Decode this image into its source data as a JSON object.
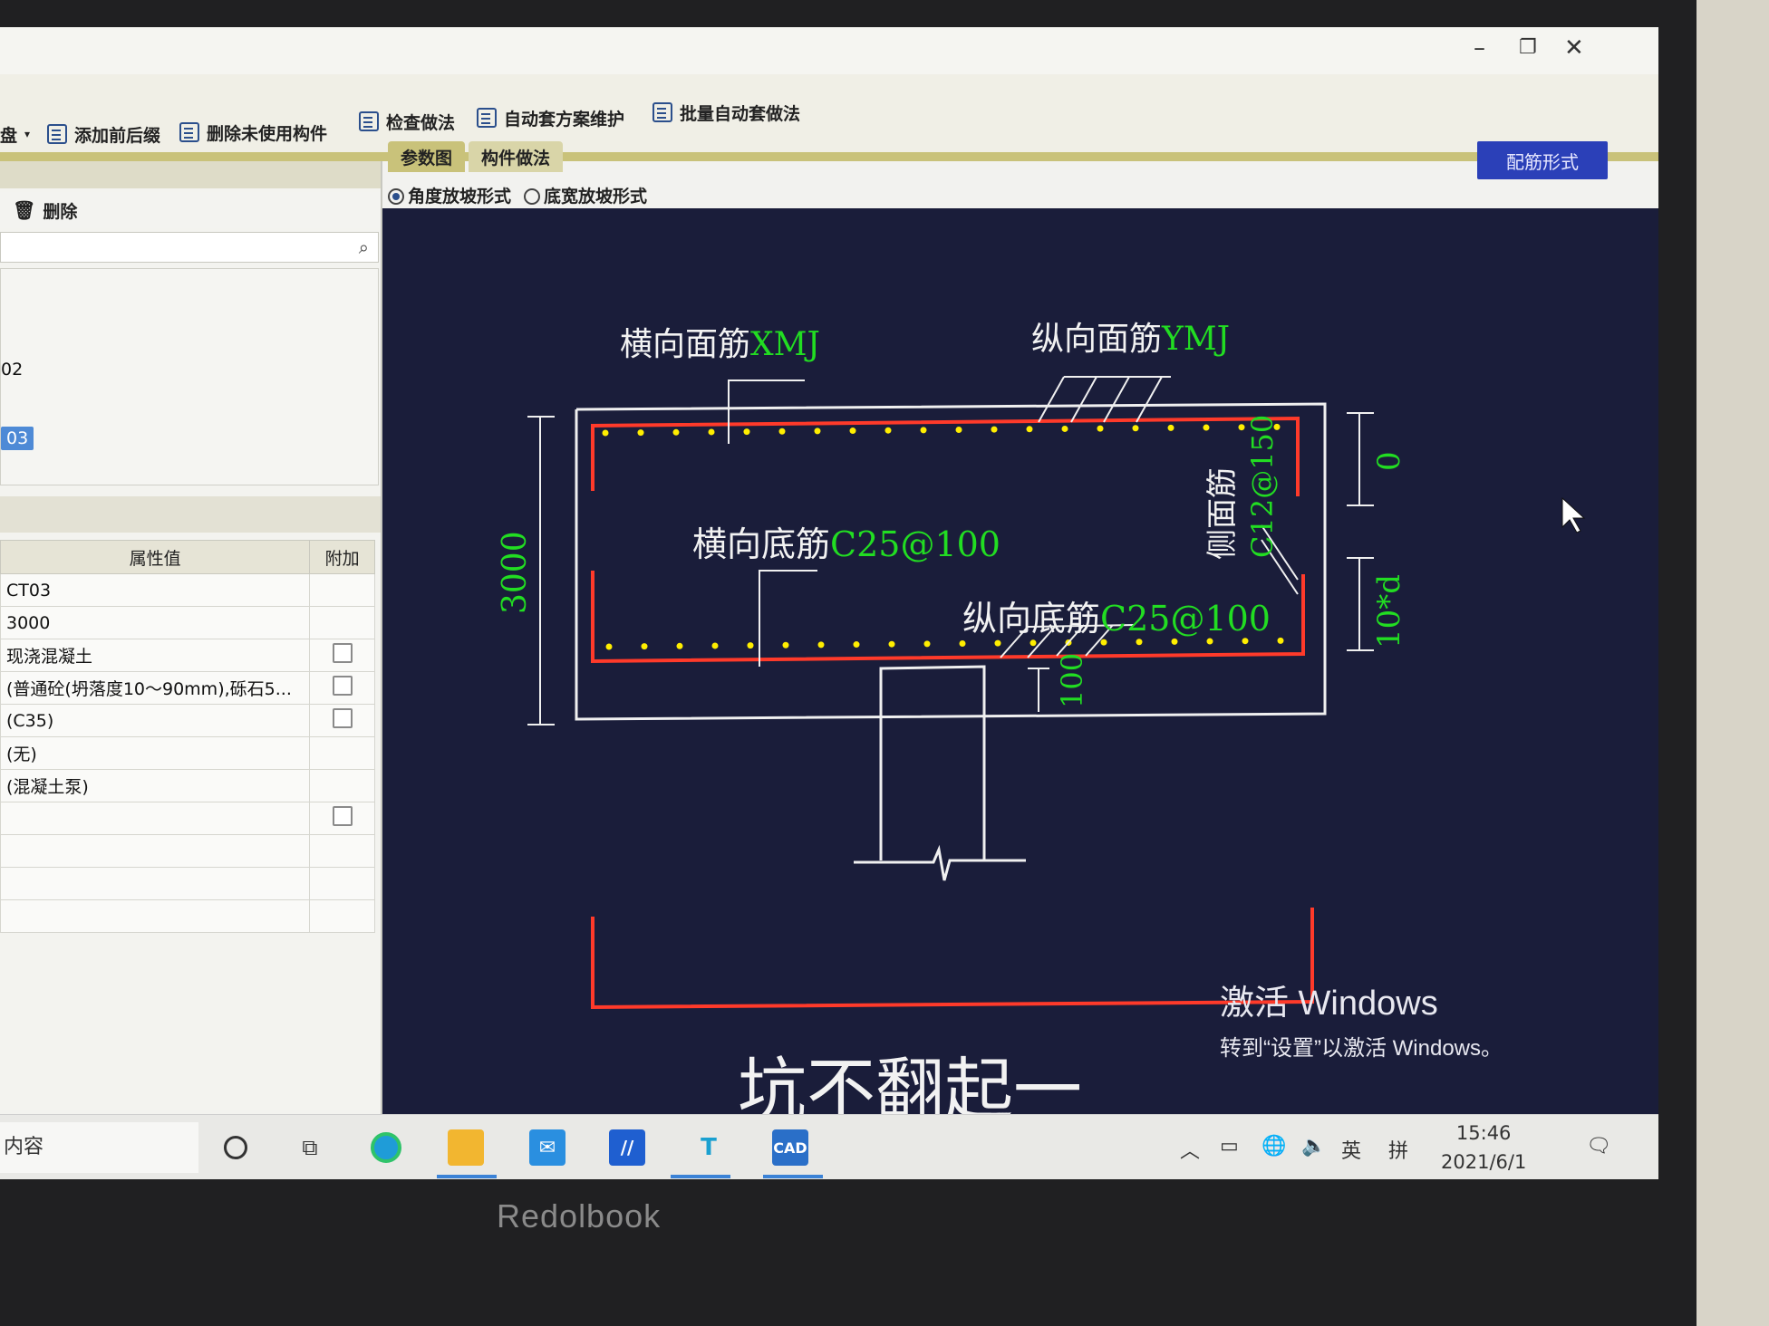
{
  "window": {
    "controls": {
      "minimize": "–",
      "restore": "❐",
      "close": "✕"
    }
  },
  "ribbon": {
    "partial_label": "盘",
    "items": [
      {
        "label": "添加前后缀",
        "icon": "list-icon"
      },
      {
        "label": "删除未使用构件",
        "icon": "list-icon"
      },
      {
        "label": "检查做法",
        "icon": "checklist-icon"
      },
      {
        "label": "自动套方案维护",
        "icon": "settings-list-icon"
      },
      {
        "label": "批量自动套做法",
        "icon": "batch-icon"
      }
    ]
  },
  "left_panel": {
    "delete_label": "删除",
    "list_items": [
      {
        "label": "02",
        "selected": false
      },
      {
        "label": "03",
        "selected": true
      }
    ],
    "table": {
      "headers": [
        "属性值",
        "附加"
      ],
      "rows": [
        {
          "value": "CT03",
          "checkbox": false
        },
        {
          "value": "3000",
          "checkbox": false
        },
        {
          "value": "现浇混凝土",
          "checkbox": true
        },
        {
          "value": "(普通砼(坍落度10～90mm),砾石5...",
          "checkbox": true
        },
        {
          "value": "(C35)",
          "checkbox": true
        },
        {
          "value": "(无)",
          "checkbox": false
        },
        {
          "value": "(混凝土泵)",
          "checkbox": false
        },
        {
          "value": "",
          "checkbox": true
        },
        {
          "value": "",
          "checkbox": false
        },
        {
          "value": "",
          "checkbox": false
        },
        {
          "value": "",
          "checkbox": false
        }
      ]
    }
  },
  "main": {
    "tabs": [
      {
        "label": "参数图",
        "active": true
      },
      {
        "label": "构件做法",
        "active": false
      }
    ],
    "rebar_button": "配筋形式",
    "radios": [
      {
        "label": "角度放坡形式",
        "checked": true
      },
      {
        "label": "底宽放坡形式",
        "checked": false
      }
    ]
  },
  "drawing": {
    "top_transverse": {
      "prefix": "横向面筋",
      "code": "XMJ"
    },
    "top_longitudinal": {
      "prefix": "纵向面筋",
      "code": "YMJ"
    },
    "bottom_transverse": {
      "prefix": "横向底筋",
      "code": "C25@100"
    },
    "bottom_longitudinal": {
      "prefix": "纵向底筋",
      "code": "C25@100"
    },
    "side": {
      "prefix": "侧面筋",
      "code": "C12@150"
    },
    "dim_height": "3000",
    "dim_right_top": "0",
    "dim_right_bottom": "10*d",
    "dim_bottom": "100",
    "bottom_partial": "坑不翻起一",
    "colors": {
      "dim": "#22dd22",
      "rebar": "#ff3a2a",
      "dots": "#ffee00",
      "lines": "#f0f0f0",
      "label": "#f2f2f2"
    }
  },
  "watermark": {
    "line1": "激活 Windows",
    "line2": "转到“设置”以激活 Windows。"
  },
  "taskbar": {
    "search_text": "内容",
    "apps": [
      "task-view-icon",
      "edge-icon",
      "folder-icon",
      "mail-icon",
      "app-ai-icon",
      "app-t-icon",
      "cad-icon"
    ],
    "cad_label": "CAD",
    "t_label": "T",
    "ime_lang": "英",
    "ime_mode": "拼",
    "time": "15:46",
    "date": "2021/6/1"
  },
  "device": {
    "brand": "Redolbook"
  }
}
